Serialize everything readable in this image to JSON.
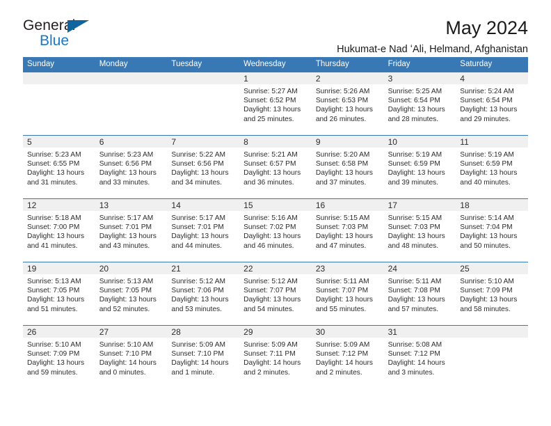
{
  "logo": {
    "word_one": "General",
    "word_two": "Blue",
    "triangle_icon": "triangle-icon",
    "accent_color": "#1878c8",
    "triangle_color": "#10659e"
  },
  "header": {
    "title": "May 2024",
    "subtitle": "Hukumat-e Nad ʻAli, Helmand, Afghanistan"
  },
  "calendar": {
    "header_background": "#3878b4",
    "header_text_color": "#ffffff",
    "daynumber_band_color": "#f0f0f0",
    "weekdays": [
      "Sunday",
      "Monday",
      "Tuesday",
      "Wednesday",
      "Thursday",
      "Friday",
      "Saturday"
    ],
    "weeks": [
      [
        {
          "day": "",
          "sunrise": "",
          "sunset": "",
          "daylight_line1": "",
          "daylight_line2": "",
          "empty": true
        },
        {
          "day": "",
          "sunrise": "",
          "sunset": "",
          "daylight_line1": "",
          "daylight_line2": "",
          "empty": true
        },
        {
          "day": "",
          "sunrise": "",
          "sunset": "",
          "daylight_line1": "",
          "daylight_line2": "",
          "empty": true
        },
        {
          "day": "1",
          "sunrise": "Sunrise: 5:27 AM",
          "sunset": "Sunset: 6:52 PM",
          "daylight_line1": "Daylight: 13 hours",
          "daylight_line2": "and 25 minutes.",
          "empty": false
        },
        {
          "day": "2",
          "sunrise": "Sunrise: 5:26 AM",
          "sunset": "Sunset: 6:53 PM",
          "daylight_line1": "Daylight: 13 hours",
          "daylight_line2": "and 26 minutes.",
          "empty": false
        },
        {
          "day": "3",
          "sunrise": "Sunrise: 5:25 AM",
          "sunset": "Sunset: 6:54 PM",
          "daylight_line1": "Daylight: 13 hours",
          "daylight_line2": "and 28 minutes.",
          "empty": false
        },
        {
          "day": "4",
          "sunrise": "Sunrise: 5:24 AM",
          "sunset": "Sunset: 6:54 PM",
          "daylight_line1": "Daylight: 13 hours",
          "daylight_line2": "and 29 minutes.",
          "empty": false
        }
      ],
      [
        {
          "day": "5",
          "sunrise": "Sunrise: 5:23 AM",
          "sunset": "Sunset: 6:55 PM",
          "daylight_line1": "Daylight: 13 hours",
          "daylight_line2": "and 31 minutes.",
          "empty": false
        },
        {
          "day": "6",
          "sunrise": "Sunrise: 5:23 AM",
          "sunset": "Sunset: 6:56 PM",
          "daylight_line1": "Daylight: 13 hours",
          "daylight_line2": "and 33 minutes.",
          "empty": false
        },
        {
          "day": "7",
          "sunrise": "Sunrise: 5:22 AM",
          "sunset": "Sunset: 6:56 PM",
          "daylight_line1": "Daylight: 13 hours",
          "daylight_line2": "and 34 minutes.",
          "empty": false
        },
        {
          "day": "8",
          "sunrise": "Sunrise: 5:21 AM",
          "sunset": "Sunset: 6:57 PM",
          "daylight_line1": "Daylight: 13 hours",
          "daylight_line2": "and 36 minutes.",
          "empty": false
        },
        {
          "day": "9",
          "sunrise": "Sunrise: 5:20 AM",
          "sunset": "Sunset: 6:58 PM",
          "daylight_line1": "Daylight: 13 hours",
          "daylight_line2": "and 37 minutes.",
          "empty": false
        },
        {
          "day": "10",
          "sunrise": "Sunrise: 5:19 AM",
          "sunset": "Sunset: 6:59 PM",
          "daylight_line1": "Daylight: 13 hours",
          "daylight_line2": "and 39 minutes.",
          "empty": false
        },
        {
          "day": "11",
          "sunrise": "Sunrise: 5:19 AM",
          "sunset": "Sunset: 6:59 PM",
          "daylight_line1": "Daylight: 13 hours",
          "daylight_line2": "and 40 minutes.",
          "empty": false
        }
      ],
      [
        {
          "day": "12",
          "sunrise": "Sunrise: 5:18 AM",
          "sunset": "Sunset: 7:00 PM",
          "daylight_line1": "Daylight: 13 hours",
          "daylight_line2": "and 41 minutes.",
          "empty": false
        },
        {
          "day": "13",
          "sunrise": "Sunrise: 5:17 AM",
          "sunset": "Sunset: 7:01 PM",
          "daylight_line1": "Daylight: 13 hours",
          "daylight_line2": "and 43 minutes.",
          "empty": false
        },
        {
          "day": "14",
          "sunrise": "Sunrise: 5:17 AM",
          "sunset": "Sunset: 7:01 PM",
          "daylight_line1": "Daylight: 13 hours",
          "daylight_line2": "and 44 minutes.",
          "empty": false
        },
        {
          "day": "15",
          "sunrise": "Sunrise: 5:16 AM",
          "sunset": "Sunset: 7:02 PM",
          "daylight_line1": "Daylight: 13 hours",
          "daylight_line2": "and 46 minutes.",
          "empty": false
        },
        {
          "day": "16",
          "sunrise": "Sunrise: 5:15 AM",
          "sunset": "Sunset: 7:03 PM",
          "daylight_line1": "Daylight: 13 hours",
          "daylight_line2": "and 47 minutes.",
          "empty": false
        },
        {
          "day": "17",
          "sunrise": "Sunrise: 5:15 AM",
          "sunset": "Sunset: 7:03 PM",
          "daylight_line1": "Daylight: 13 hours",
          "daylight_line2": "and 48 minutes.",
          "empty": false
        },
        {
          "day": "18",
          "sunrise": "Sunrise: 5:14 AM",
          "sunset": "Sunset: 7:04 PM",
          "daylight_line1": "Daylight: 13 hours",
          "daylight_line2": "and 50 minutes.",
          "empty": false
        }
      ],
      [
        {
          "day": "19",
          "sunrise": "Sunrise: 5:13 AM",
          "sunset": "Sunset: 7:05 PM",
          "daylight_line1": "Daylight: 13 hours",
          "daylight_line2": "and 51 minutes.",
          "empty": false
        },
        {
          "day": "20",
          "sunrise": "Sunrise: 5:13 AM",
          "sunset": "Sunset: 7:05 PM",
          "daylight_line1": "Daylight: 13 hours",
          "daylight_line2": "and 52 minutes.",
          "empty": false
        },
        {
          "day": "21",
          "sunrise": "Sunrise: 5:12 AM",
          "sunset": "Sunset: 7:06 PM",
          "daylight_line1": "Daylight: 13 hours",
          "daylight_line2": "and 53 minutes.",
          "empty": false
        },
        {
          "day": "22",
          "sunrise": "Sunrise: 5:12 AM",
          "sunset": "Sunset: 7:07 PM",
          "daylight_line1": "Daylight: 13 hours",
          "daylight_line2": "and 54 minutes.",
          "empty": false
        },
        {
          "day": "23",
          "sunrise": "Sunrise: 5:11 AM",
          "sunset": "Sunset: 7:07 PM",
          "daylight_line1": "Daylight: 13 hours",
          "daylight_line2": "and 55 minutes.",
          "empty": false
        },
        {
          "day": "24",
          "sunrise": "Sunrise: 5:11 AM",
          "sunset": "Sunset: 7:08 PM",
          "daylight_line1": "Daylight: 13 hours",
          "daylight_line2": "and 57 minutes.",
          "empty": false
        },
        {
          "day": "25",
          "sunrise": "Sunrise: 5:10 AM",
          "sunset": "Sunset: 7:09 PM",
          "daylight_line1": "Daylight: 13 hours",
          "daylight_line2": "and 58 minutes.",
          "empty": false
        }
      ],
      [
        {
          "day": "26",
          "sunrise": "Sunrise: 5:10 AM",
          "sunset": "Sunset: 7:09 PM",
          "daylight_line1": "Daylight: 13 hours",
          "daylight_line2": "and 59 minutes.",
          "empty": false
        },
        {
          "day": "27",
          "sunrise": "Sunrise: 5:10 AM",
          "sunset": "Sunset: 7:10 PM",
          "daylight_line1": "Daylight: 14 hours",
          "daylight_line2": "and 0 minutes.",
          "empty": false
        },
        {
          "day": "28",
          "sunrise": "Sunrise: 5:09 AM",
          "sunset": "Sunset: 7:10 PM",
          "daylight_line1": "Daylight: 14 hours",
          "daylight_line2": "and 1 minute.",
          "empty": false
        },
        {
          "day": "29",
          "sunrise": "Sunrise: 5:09 AM",
          "sunset": "Sunset: 7:11 PM",
          "daylight_line1": "Daylight: 14 hours",
          "daylight_line2": "and 2 minutes.",
          "empty": false
        },
        {
          "day": "30",
          "sunrise": "Sunrise: 5:09 AM",
          "sunset": "Sunset: 7:12 PM",
          "daylight_line1": "Daylight: 14 hours",
          "daylight_line2": "and 2 minutes.",
          "empty": false
        },
        {
          "day": "31",
          "sunrise": "Sunrise: 5:08 AM",
          "sunset": "Sunset: 7:12 PM",
          "daylight_line1": "Daylight: 14 hours",
          "daylight_line2": "and 3 minutes.",
          "empty": false
        },
        {
          "day": "",
          "sunrise": "",
          "sunset": "",
          "daylight_line1": "",
          "daylight_line2": "",
          "empty": true
        }
      ]
    ]
  }
}
